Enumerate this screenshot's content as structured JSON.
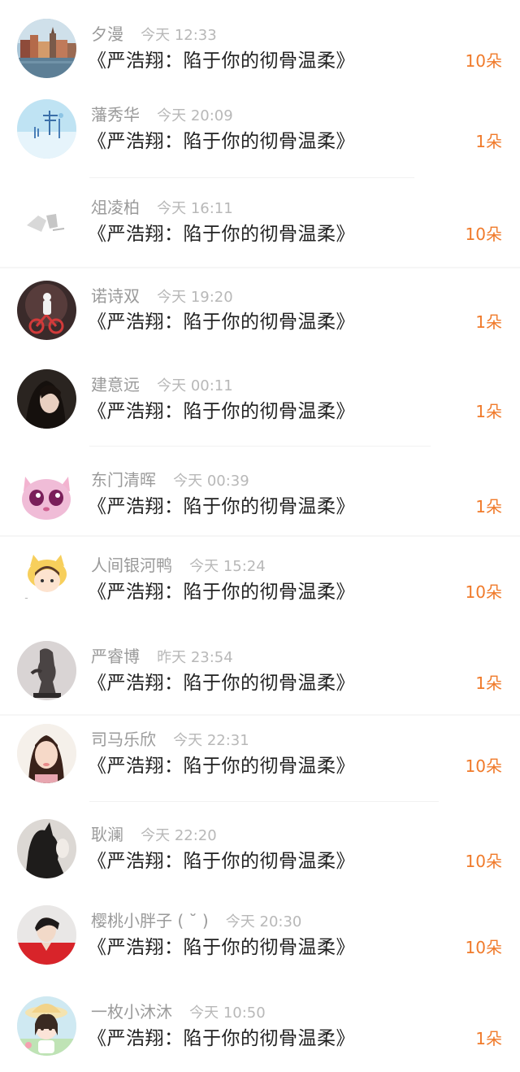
{
  "entries": [
    {
      "name": "夕漫",
      "time": "今天 12:33",
      "title": "《严浩翔：陷于你的彻骨温柔》",
      "count": "10朵"
    },
    {
      "name": "藩秀华",
      "time": "今天 20:09",
      "title": "《严浩翔：陷于你的彻骨温柔》",
      "count": "1朵"
    },
    {
      "name": "俎凌柏",
      "time": "今天 16:11",
      "title": "《严浩翔：陷于你的彻骨温柔》",
      "count": "10朵"
    },
    {
      "name": "诺诗双",
      "time": "今天 19:20",
      "title": "《严浩翔：陷于你的彻骨温柔》",
      "count": "1朵"
    },
    {
      "name": "建意远",
      "time": "今天 00:11",
      "title": "《严浩翔：陷于你的彻骨温柔》",
      "count": "1朵"
    },
    {
      "name": "东门清晖",
      "time": "今天 00:39",
      "title": "《严浩翔：陷于你的彻骨温柔》",
      "count": "1朵"
    },
    {
      "name": "人间银河鸭",
      "time": "今天 15:24",
      "title": "《严浩翔：陷于你的彻骨温柔》",
      "count": "10朵"
    },
    {
      "name": "严睿博",
      "time": "昨天 23:54",
      "title": "《严浩翔：陷于你的彻骨温柔》",
      "count": "1朵"
    },
    {
      "name": "司马乐欣",
      "time": "今天 22:31",
      "title": "《严浩翔：陷于你的彻骨温柔》",
      "count": "10朵"
    },
    {
      "name": "耿澜",
      "time": "今天 22:20",
      "title": "《严浩翔：陷于你的彻骨温柔》",
      "count": "10朵"
    },
    {
      "name": "樱桃小胖子 ( ˘ )",
      "time": "今天 20:30",
      "title": "《严浩翔：陷于你的彻骨温柔》",
      "count": "10朵"
    },
    {
      "name": "一枚小沐沐",
      "time": "今天 10:50",
      "title": "《严浩翔：陷于你的彻骨温柔》",
      "count": "1朵"
    }
  ],
  "colors": {
    "accent": "#f07a2a",
    "name": "#9a9a9a",
    "time": "#b8b8b8",
    "title": "#222222"
  }
}
